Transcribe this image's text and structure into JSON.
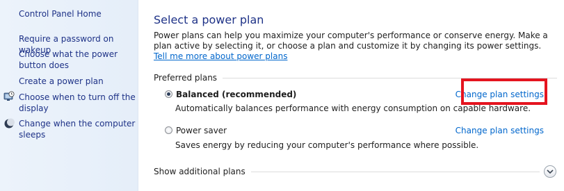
{
  "sidebar": {
    "items": [
      {
        "label": "Control Panel Home",
        "icon": null
      },
      {
        "label": "Require a password on wakeup",
        "icon": null
      },
      {
        "label": "Choose what the power button does",
        "icon": null
      },
      {
        "label": "Create a power plan",
        "icon": null
      },
      {
        "label": "Choose when to turn off the display",
        "icon": "display-clock-icon"
      },
      {
        "label": "Change when the computer sleeps",
        "icon": "moon-icon"
      }
    ]
  },
  "main": {
    "title": "Select a power plan",
    "intro_text": "Power plans can help you maximize your computer's performance or conserve energy. Make a plan active by selecting it, or choose a plan and customize it by changing its power settings. ",
    "intro_link": "Tell me more about power plans",
    "preferred_heading": "Preferred plans",
    "plans": [
      {
        "name": "Balanced (recommended)",
        "selected": true,
        "change_label": "Change plan settings",
        "description": "Automatically balances performance with energy consumption on capable hardware."
      },
      {
        "name": "Power saver",
        "selected": false,
        "change_label": "Change plan settings",
        "description": "Saves energy by reducing your computer's performance where possible."
      }
    ],
    "additional_heading": "Show additional plans"
  },
  "colors": {
    "link": "#0066cc",
    "title": "#1e3287",
    "highlight": "#e5141f",
    "sidebar_bg": "#e5eef9"
  }
}
